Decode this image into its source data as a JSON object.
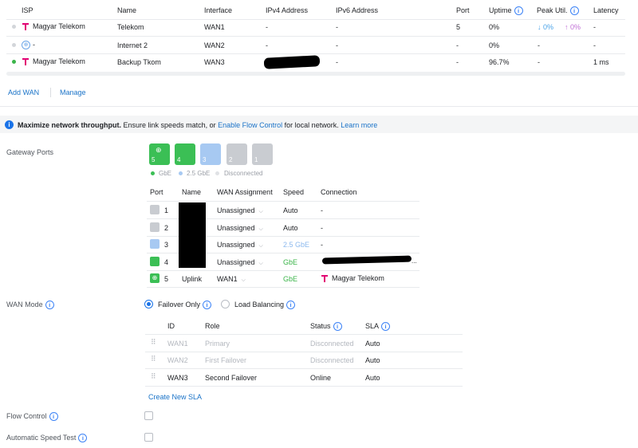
{
  "isp_table": {
    "headers": [
      "ISP",
      "Name",
      "Interface",
      "IPv4 Address",
      "IPv6 Address",
      "Port",
      "Uptime",
      "Peak Util.",
      "Latency"
    ],
    "rows": [
      {
        "status": "idle",
        "isp": "Magyar Telekom",
        "name": "Telekom",
        "interface": "WAN1",
        "ipv4": "-",
        "ipv6": "-",
        "port": "5",
        "uptime": "0%",
        "peak_down": "↓ 0%",
        "peak_up": "↑ 0%",
        "latency": "-"
      },
      {
        "status": "idle",
        "isp": "-",
        "name": "Internet 2",
        "interface": "WAN2",
        "ipv4": "-",
        "ipv6": "-",
        "port": "-",
        "uptime": "0%",
        "peak": "-",
        "latency": "-"
      },
      {
        "status": "online",
        "isp": "Magyar Telekom",
        "name": "Backup Tkom",
        "interface": "WAN3",
        "ipv4": "",
        "ipv6": "-",
        "port": "-",
        "uptime": "96.7%",
        "peak": "-",
        "latency": "1 ms"
      }
    ]
  },
  "actions": {
    "add_wan": "Add WAN",
    "manage": "Manage"
  },
  "banner": {
    "bold": "Maximize network throughput.",
    "text": "Ensure link speeds match, or",
    "link": "Enable Flow Control",
    "text2": "for local network.",
    "learn_more": "Learn more"
  },
  "gateway_ports": {
    "label": "Gateway Ports",
    "ports": [
      {
        "number": "5",
        "state": "gbe",
        "uplink": true
      },
      {
        "number": "4",
        "state": "gbe"
      },
      {
        "number": "3",
        "state": "2.5gbe"
      },
      {
        "number": "2",
        "state": "disconnected"
      },
      {
        "number": "1",
        "state": "disconnected"
      }
    ],
    "legend": {
      "gbe": "GbE",
      "gbe25": "2.5 GbE",
      "disconnected": "Disconnected"
    },
    "colors": {
      "gbe": "#3bbf55",
      "gbe25": "#a7c9f2",
      "disconnected": "#c9ccd1"
    },
    "table_headers": [
      "Port",
      "Name",
      "WAN Assignment",
      "Speed",
      "Connection"
    ],
    "rows": [
      {
        "port": "1",
        "name": "",
        "wan": "Unassigned",
        "speed": "Auto",
        "connection": "-"
      },
      {
        "port": "2",
        "name": "",
        "wan": "Unassigned",
        "speed": "Auto",
        "connection": "-"
      },
      {
        "port": "3",
        "name": "",
        "wan": "Unassigned",
        "speed": "2.5 GbE",
        "connection": "-"
      },
      {
        "port": "4",
        "name": "",
        "wan": "Unassigned",
        "speed": "GbE",
        "connection": ""
      },
      {
        "port": "5",
        "name": "Uplink",
        "wan": "WAN1",
        "speed": "GbE",
        "connection": "Magyar Telekom"
      }
    ]
  },
  "wan_mode": {
    "label": "WAN Mode",
    "options": {
      "failover": "Failover Only",
      "load_balancing": "Load Balancing"
    },
    "selected": "failover",
    "table_headers": [
      "ID",
      "Role",
      "Status",
      "SLA"
    ],
    "rows": [
      {
        "id": "WAN1",
        "role": "Primary",
        "status": "Disconnected",
        "sla": "Auto"
      },
      {
        "id": "WAN2",
        "role": "First Failover",
        "status": "Disconnected",
        "sla": "Auto"
      },
      {
        "id": "WAN3",
        "role": "Second Failover",
        "status": "Online",
        "sla": "Auto"
      }
    ],
    "create_sla": "Create New SLA"
  },
  "flow_control": {
    "label": "Flow Control",
    "checked": false
  },
  "auto_speed_test": {
    "label": "Automatic Speed Test",
    "checked": false
  }
}
